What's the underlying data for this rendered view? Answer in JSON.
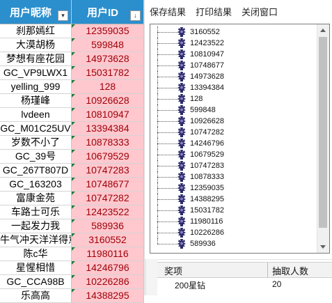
{
  "sheet": {
    "header_name": "用户昵称",
    "header_id": "用户ID",
    "filter_icon_a": "▾",
    "filter_icon_b": "↓",
    "rows": [
      {
        "name": "刹那嫣红",
        "id": "12359035"
      },
      {
        "name": "大漠胡杨",
        "id": "599848"
      },
      {
        "name": "梦想有座花园",
        "id": "14973628"
      },
      {
        "name": "GC_VP9LWX1",
        "id": "15031782"
      },
      {
        "name": "yelling_999",
        "id": "128"
      },
      {
        "name": "杨瑾峰",
        "id": "10926628"
      },
      {
        "name": "lvdeen",
        "id": "10810947"
      },
      {
        "name": "GC_M01C25UV",
        "id": "13394384"
      },
      {
        "name": "岁数不小了",
        "id": "10878333"
      },
      {
        "name": "GC_39号",
        "id": "10679529"
      },
      {
        "name": "GC_267T807D",
        "id": "10747283"
      },
      {
        "name": "GC_163203",
        "id": "10748677"
      },
      {
        "name": "富康金苑",
        "id": "10747282"
      },
      {
        "name": "车路士可乐",
        "id": "12423522"
      },
      {
        "name": "一起发力我",
        "id": "589936"
      },
      {
        "name": "牛气冲天洋洋得意",
        "id": "3160552"
      },
      {
        "name": "陈c华",
        "id": "11980116"
      },
      {
        "name": "星惺相惜",
        "id": "14246796"
      },
      {
        "name": "GC_CCA98B",
        "id": "10226286"
      },
      {
        "name": "乐高高",
        "id": "14388295"
      }
    ],
    "id_cell_bg": "#ffc7ce",
    "id_cell_text": "#9c0006",
    "header_bg": "#2b8fcd"
  },
  "dialog": {
    "menu": [
      "保存结果",
      "打印结果",
      "关闭窗口"
    ],
    "tree_icon": "person-icon",
    "tree_items": [
      "3160552",
      "12423522",
      "10810947",
      "10748677",
      "14973628",
      "13394384",
      "128",
      "599848",
      "10926628",
      "10747282",
      "14246796",
      "10679529",
      "10747283",
      "10878333",
      "12359035",
      "14388295",
      "15031782",
      "11980116",
      "10226286",
      "589936"
    ]
  },
  "prize_table": {
    "col_prize": "奖项",
    "col_count": "抽取人数",
    "rows": [
      {
        "prize": "200星钻",
        "count": "20"
      }
    ]
  }
}
